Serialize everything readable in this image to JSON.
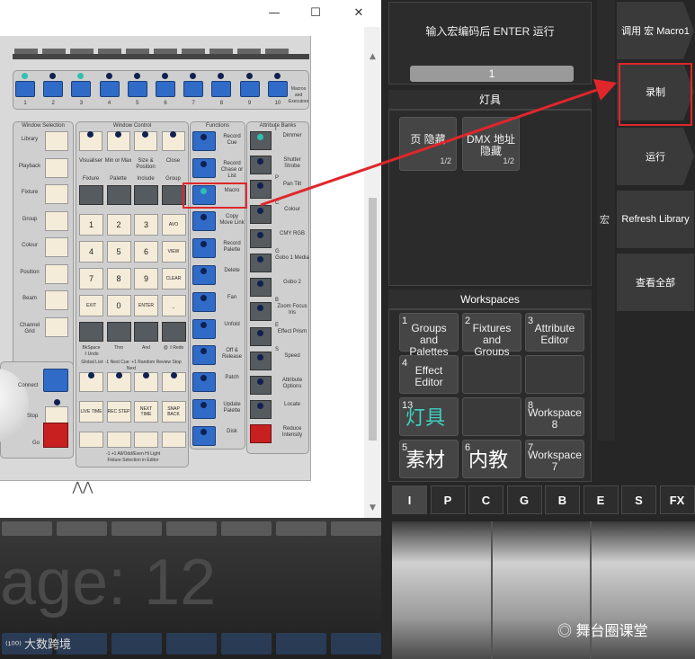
{
  "window": {
    "minimize_glyph": "—",
    "maximize_glyph": "☐",
    "close_glyph": "✕"
  },
  "console": {
    "executor_numbers": [
      "1",
      "2",
      "3",
      "4",
      "5",
      "6",
      "7",
      "8",
      "9",
      "10"
    ],
    "macro_label": "Macros and Executors",
    "sections": {
      "window_selection": "Window Selection",
      "window_control": "Window Control",
      "functions": "Functions",
      "attribute_banks": "Attribute Banks"
    },
    "window_selection_items": [
      "Library",
      "Playback",
      "Fixture",
      "Group",
      "Colour",
      "Position",
      "Beam",
      "Channel Grid"
    ],
    "window_control_labels": [
      "Visualiser",
      "Min or Max",
      "Size & Position",
      "Close"
    ],
    "key_headers": [
      "Fixture",
      "Palette",
      "Include",
      "Group"
    ],
    "keypad": [
      [
        "1",
        "2",
        "3",
        "AVO"
      ],
      [
        "4",
        "5",
        "6",
        "VIEW"
      ],
      [
        "7",
        "8",
        "9",
        "CLEAR"
      ],
      [
        "EXIT",
        "0",
        "ENTER",
        "."
      ]
    ],
    "bottom_key_labels": [
      "BkSpace ⇧Undo",
      "Thro",
      "And",
      "@ ⇧Redo"
    ],
    "lower_labels_small": "Global List: -1  Next Cue: +1  Random Review  Stop Next",
    "lower_keys": [
      "LIVE TIME",
      "REC STEP",
      "NEXT TIME",
      "SNAP BACK"
    ],
    "fixture_selection_caption": "-1   +1   All/Odd/Even   Hi Light",
    "fixture_selection_sub": "Fixture Selection in Editor",
    "playback_labels": [
      "Connect",
      "Stop",
      "Go"
    ],
    "function_labels": [
      "Record Cue",
      "Record Chase or List",
      "Macro",
      "Copy Move Link",
      "Record Palette",
      "Delete",
      "Fan",
      "Unfold",
      "Off & Release",
      "Patch",
      "Update Palette",
      "Disk"
    ],
    "attribute_labels": [
      "Dimmer",
      "Shutter Strobe",
      "Pan Tilt",
      "Colour",
      "CMY RGB",
      "Gobo 1 Media",
      "Gobo 2",
      "Zoom Focus Iris",
      "Effect Prism",
      "Speed",
      "Attribute Options",
      "Locate",
      "Reduce Intensity"
    ],
    "attribute_letters": [
      "I",
      "",
      "P",
      "C",
      "",
      "G",
      "",
      "B",
      "E",
      "S",
      "",
      "",
      ""
    ],
    "page_watermark": "age: 12",
    "brand_watermark": "大数跨境"
  },
  "right": {
    "prompt": "输入宏编码后 ENTER 运行",
    "input_value": "1",
    "fixtures_title": "灯具",
    "fixture_tiles": [
      {
        "label": "页 隐藏",
        "page": "1/2"
      },
      {
        "label": "DMX 地址 隐藏",
        "page": "1/2"
      }
    ],
    "workspaces_title": "Workspaces",
    "workspaces": [
      {
        "n": "1",
        "label": "Groups and Palettes"
      },
      {
        "n": "2",
        "label": "Fixtures and Groups"
      },
      {
        "n": "3",
        "label": "Attribute Editor"
      },
      {
        "n": "4",
        "label": "Effect Editor"
      },
      {
        "n": "",
        "label": ""
      },
      {
        "n": "",
        "label": ""
      },
      {
        "n": "13",
        "label": "灯具"
      },
      {
        "n": "",
        "label": ""
      },
      {
        "n": "8",
        "label": "Workspace 8"
      },
      {
        "n": "5",
        "label": "素材"
      },
      {
        "n": "6",
        "label": "内教"
      },
      {
        "n": "7",
        "label": "Workspace 7"
      }
    ],
    "tabs": [
      "I",
      "P",
      "C",
      "G",
      "B",
      "E",
      "S",
      "FX"
    ],
    "side_buttons": [
      "调用 宏 Macro1",
      "录制",
      "运行",
      "Refresh Library",
      "查看全部"
    ],
    "vertical_text": "宏",
    "wechat_watermark": "舞台圈课堂"
  }
}
